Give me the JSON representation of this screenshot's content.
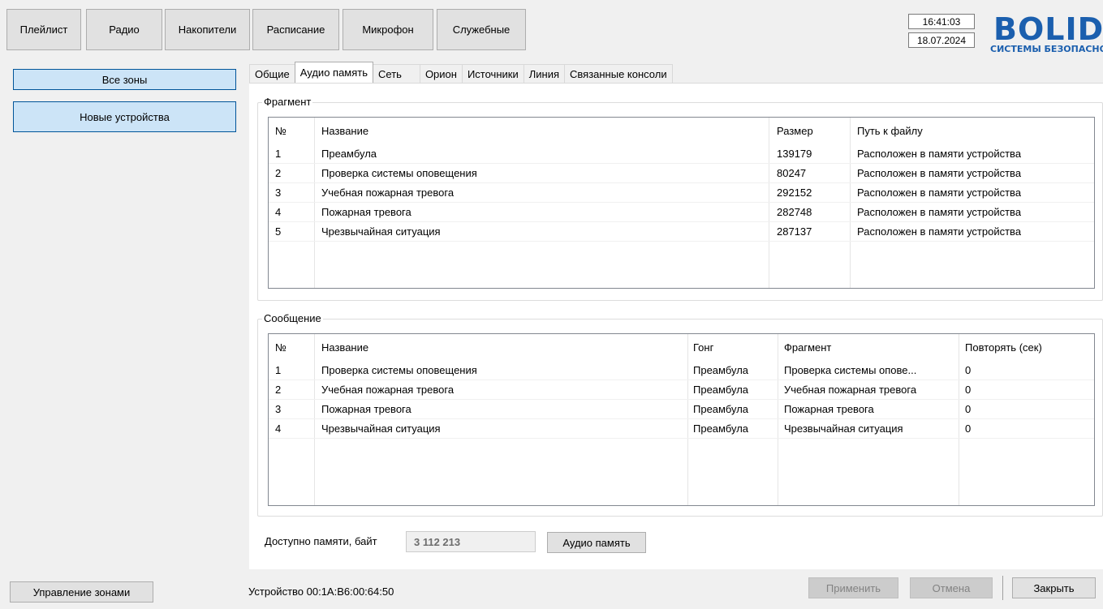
{
  "top_buttons": [
    "Плейлист",
    "Радио",
    "Накопители",
    "Расписание",
    "Микрофон",
    "Служебные"
  ],
  "clock": {
    "time": "16:41:03",
    "date": "18.07.2024"
  },
  "logo": {
    "text": "BOLID",
    "subtitle": "СИСТЕМЫ БЕЗОПАСНОСТИ"
  },
  "left": {
    "all_zones": "Все зоны",
    "new_devices": "Новые устройства",
    "zone_management": "Управление зонами"
  },
  "tabs": [
    "Общие",
    "Аудио память",
    "Сеть",
    "Орион",
    "Источники",
    "Линия",
    "Связанные консоли"
  ],
  "active_tab": "Аудио память",
  "fragment": {
    "group_title": "Фрагмент",
    "columns": [
      "№",
      "Название",
      "Размер",
      "Путь к файлу"
    ],
    "rows": [
      [
        "1",
        "Преамбула",
        "139179",
        "Расположен в памяти устройства"
      ],
      [
        "2",
        "Проверка системы оповещения",
        "80247",
        "Расположен в памяти устройства"
      ],
      [
        "3",
        "Учебная пожарная тревога",
        "292152",
        "Расположен в памяти устройства"
      ],
      [
        "4",
        "Пожарная тревога",
        "282748",
        "Расположен в памяти устройства"
      ],
      [
        "5",
        "Чрезвычайная ситуация",
        "287137",
        "Расположен в памяти устройства"
      ]
    ]
  },
  "message": {
    "group_title": "Сообщение",
    "columns": [
      "№",
      "Название",
      "Гонг",
      "Фрагмент",
      "Повторять (сек)"
    ],
    "rows": [
      [
        "1",
        "Проверка системы оповещения",
        "Преамбула",
        "Проверка системы опове...",
        "0"
      ],
      [
        "2",
        "Учебная пожарная тревога",
        "Преамбула",
        "Учебная пожарная тревога",
        "0"
      ],
      [
        "3",
        "Пожарная тревога",
        "Преамбула",
        "Пожарная тревога",
        "0"
      ],
      [
        "4",
        "Чрезвычайная ситуация",
        "Преамбула",
        "Чрезвычайная ситуация",
        "0"
      ]
    ]
  },
  "memory": {
    "label": "Доступно памяти, байт",
    "value": "3 112 213",
    "button": "Аудио память"
  },
  "status": "Устройство 00:1A:B6:00:64:50",
  "footer": {
    "apply": "Применить",
    "cancel": "Отмена",
    "close": "Закрыть"
  }
}
